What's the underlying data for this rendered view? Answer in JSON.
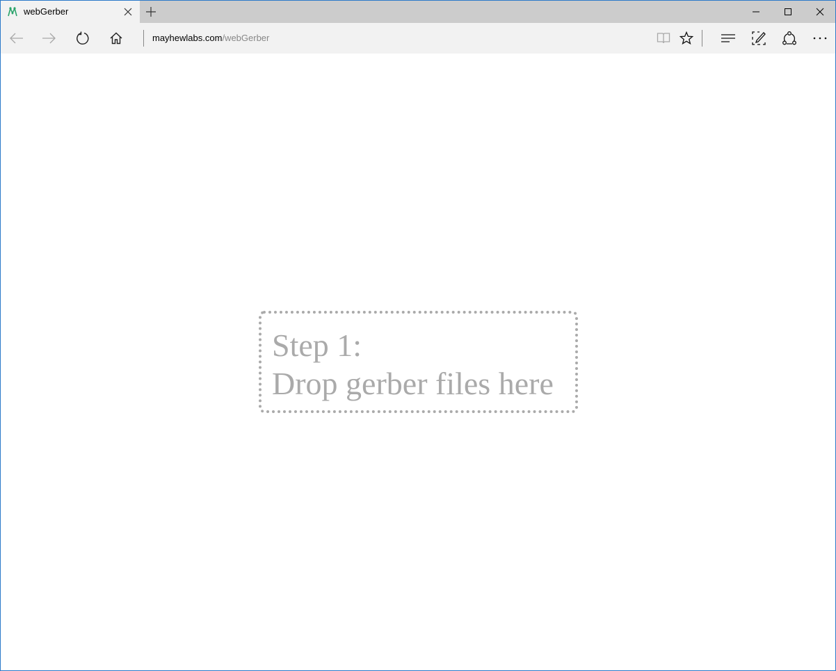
{
  "browser": {
    "tab": {
      "title": "webGerber",
      "favicon": "webgerber-favicon"
    },
    "address": {
      "host": "mayhewlabs.com",
      "path": "/webGerber"
    },
    "icons": {
      "back": "back-arrow-icon",
      "forward": "forward-arrow-icon",
      "refresh": "refresh-icon",
      "home": "home-icon",
      "reading_view": "reading-view-icon",
      "favorite": "star-icon",
      "hub": "hub-icon",
      "web_note": "web-note-icon",
      "share": "share-icon",
      "more": "more-icon",
      "minimize": "minimize-icon",
      "maximize": "maximize-icon",
      "close": "close-icon",
      "new_tab": "plus-icon"
    },
    "colors": {
      "window_border": "#2b79c9",
      "chrome": "#f2f2f2",
      "tabstrip": "#cccccc"
    }
  },
  "page": {
    "dropzone": {
      "line1": "Step 1:",
      "line2": "Drop gerber files here",
      "color": "#aaaaaa"
    }
  }
}
